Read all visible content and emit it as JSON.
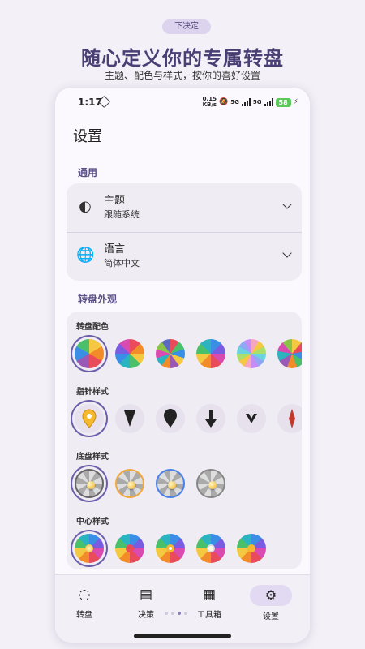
{
  "promo": {
    "badge": "下决定",
    "title": "随心定义你的专属转盘",
    "subtitle": "主题、配色与样式，按你的喜好设置"
  },
  "statusbar": {
    "time": "1:17",
    "netspeed_value": "0.15",
    "netspeed_unit": "KB/s",
    "signal1": "5G",
    "signal2": "5G",
    "battery": "58"
  },
  "page": {
    "title": "设置"
  },
  "general": {
    "label": "通用",
    "theme": {
      "title": "主题",
      "value": "跟随系统"
    },
    "language": {
      "title": "语言",
      "value": "简体中文"
    }
  },
  "appearance": {
    "label": "转盘外观",
    "colors_label": "转盘配色",
    "pointer_label": "指针样式",
    "base_label": "底盘样式",
    "center_label": "中心样式"
  },
  "tabs": [
    {
      "label": "转盘",
      "icon": "spinner-icon"
    },
    {
      "label": "决策",
      "icon": "list-icon"
    },
    {
      "label": "工具箱",
      "icon": "grid-icon"
    },
    {
      "label": "设置",
      "icon": "gear-icon"
    }
  ],
  "colors": {
    "accent": "#6a5fa8",
    "title": "#4a3f75"
  }
}
